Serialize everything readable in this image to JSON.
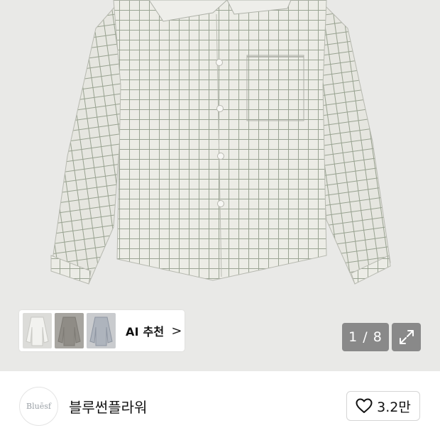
{
  "gallery": {
    "counter": "1 / 8",
    "expand_icon": "expand-icon"
  },
  "ai_recommend": {
    "label": "AI 추천",
    "chevron": ">",
    "thumbnails": [
      {
        "name": "white-shirt-thumb"
      },
      {
        "name": "gray-shirt-thumb"
      },
      {
        "name": "blue-check-shirt-thumb"
      }
    ]
  },
  "store": {
    "logo_text": "Bluēsf",
    "name": "블루썬플라워"
  },
  "like": {
    "icon": "heart-icon",
    "count": "3.2만"
  },
  "colors": {
    "hero_bg": "#e9e9e7",
    "overlay": "#6e6e6e"
  }
}
